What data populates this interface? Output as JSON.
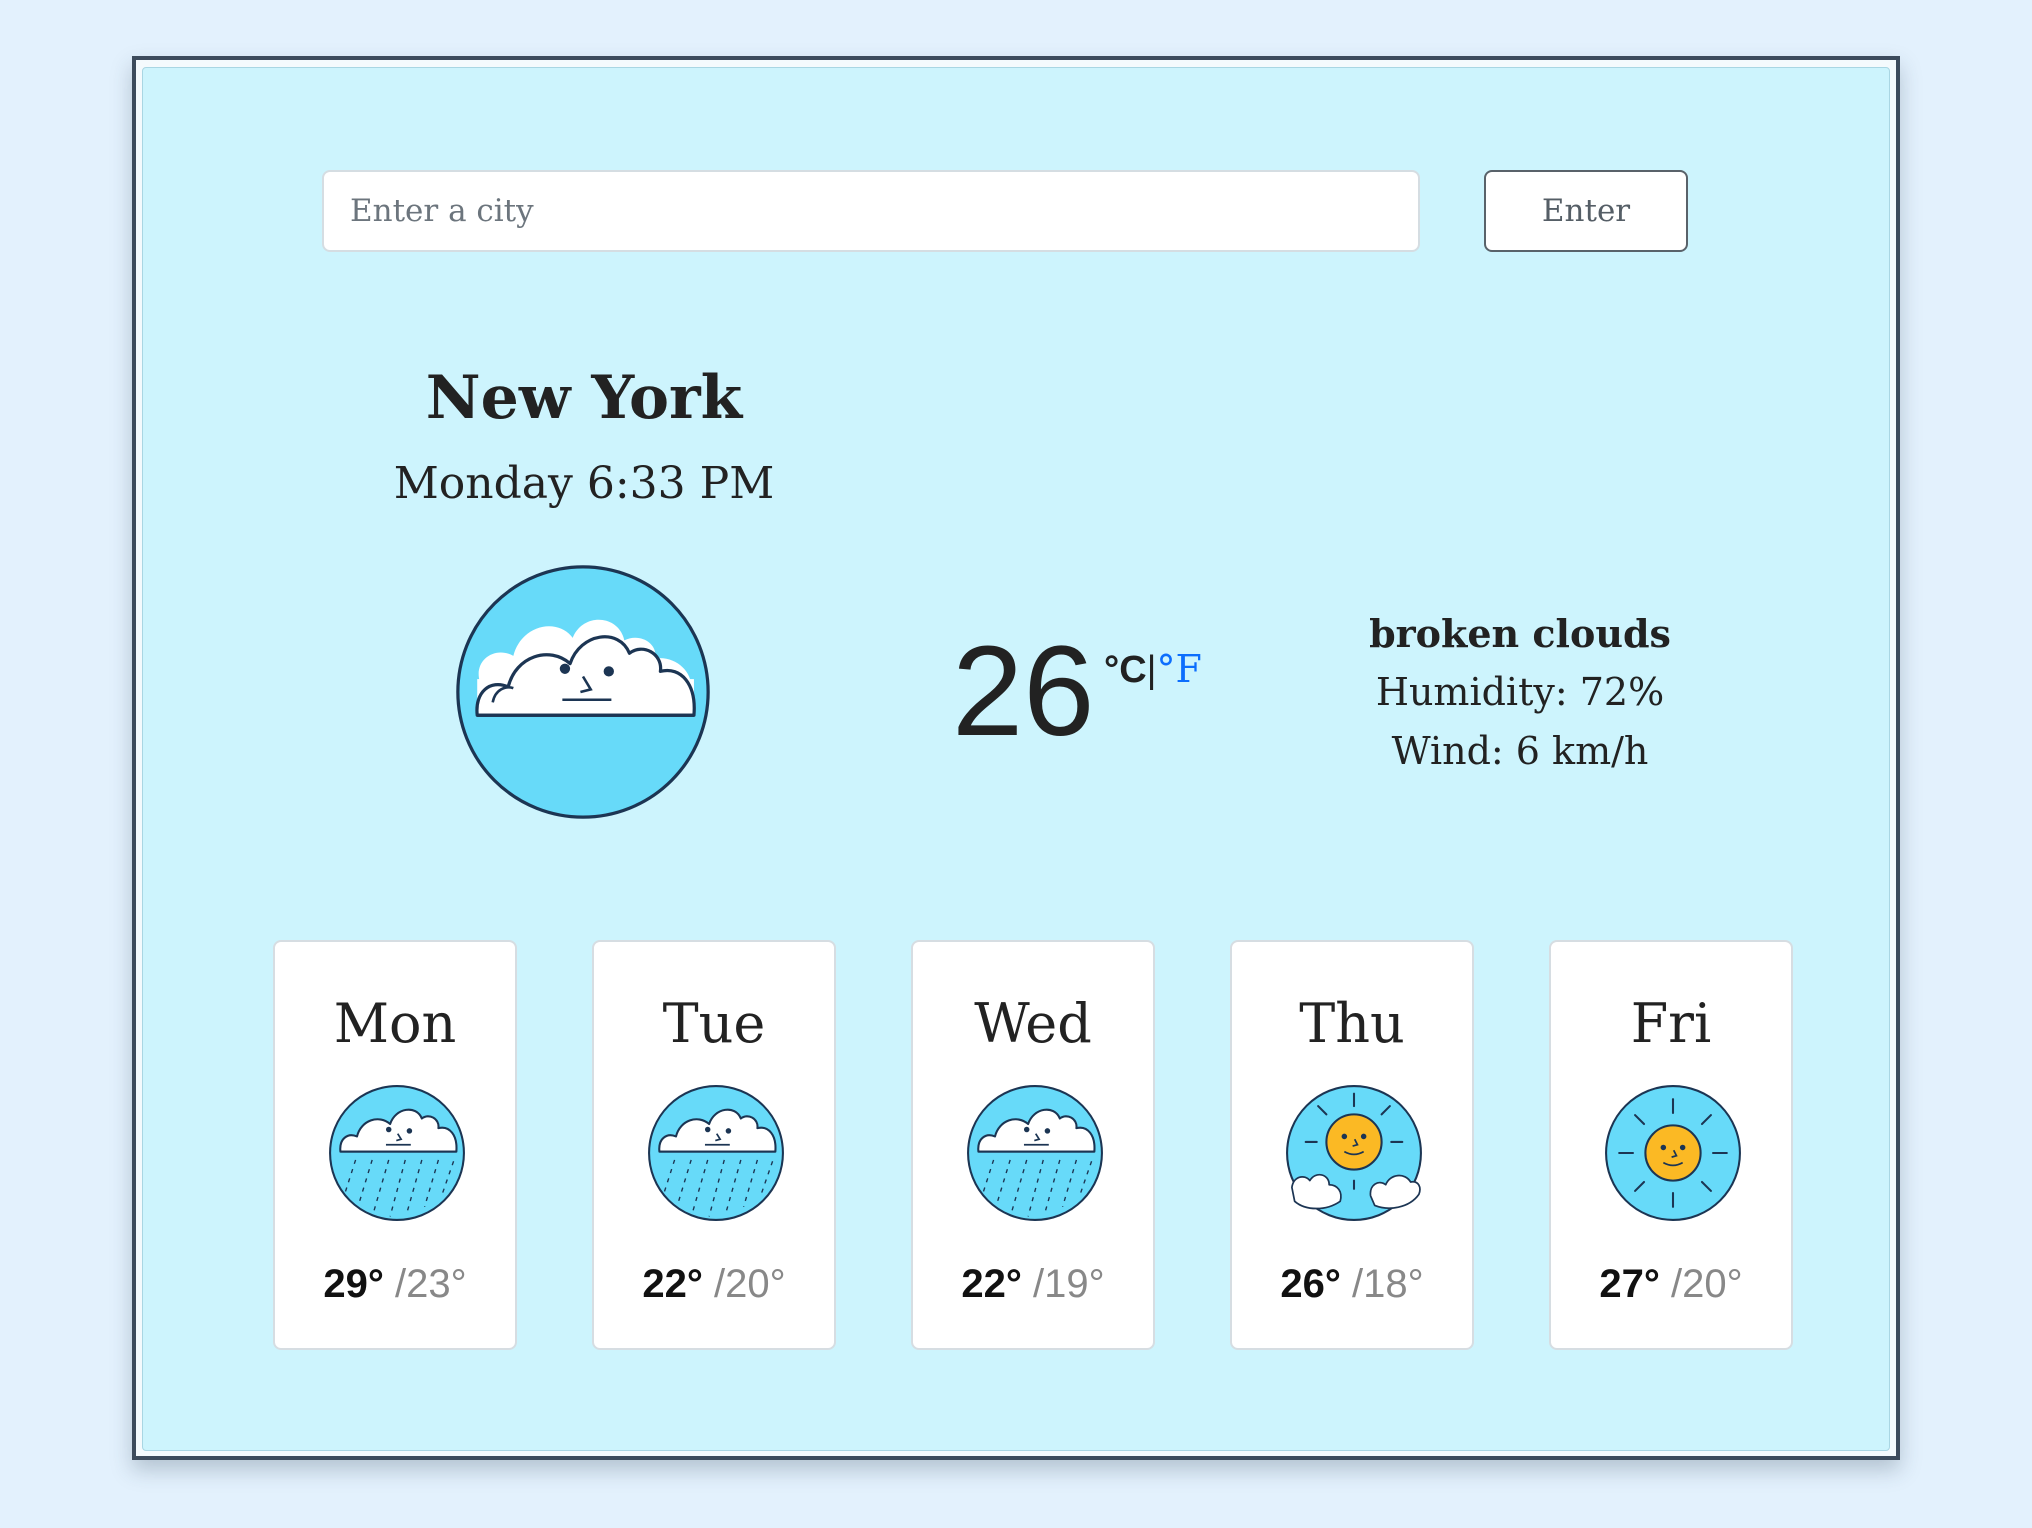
{
  "search": {
    "placeholder": "Enter a city",
    "value": "",
    "button_label": "Enter"
  },
  "current": {
    "city": "New York",
    "datetime": "Monday 6:33 PM",
    "icon": "cloud-icon",
    "temperature": "26",
    "unit_celsius": "°C",
    "unit_separator": "|",
    "unit_fahrenheit": "°F",
    "description": "broken clouds",
    "humidity": "Humidity: 72%",
    "wind": "Wind: 6 km/h"
  },
  "forecast": [
    {
      "day": "Mon",
      "high": "29°",
      "low": " /23°",
      "icon": "rain-cloud-icon"
    },
    {
      "day": "Tue",
      "high": "22°",
      "low": " /20°",
      "icon": "rain-cloud-icon"
    },
    {
      "day": "Wed",
      "high": "22°",
      "low": " /19°",
      "icon": "rain-cloud-icon"
    },
    {
      "day": "Thu",
      "high": "26°",
      "low": " /18°",
      "icon": "sun-cloud-icon"
    },
    {
      "day": "Fri",
      "high": "27°",
      "low": " /20°",
      "icon": "sun-icon"
    }
  ],
  "colors": {
    "background": "#e3f1fd",
    "panel": "#cdf4fd",
    "icon_fill": "#67daf9",
    "sun": "#fbb924",
    "link": "#0d6efd"
  }
}
